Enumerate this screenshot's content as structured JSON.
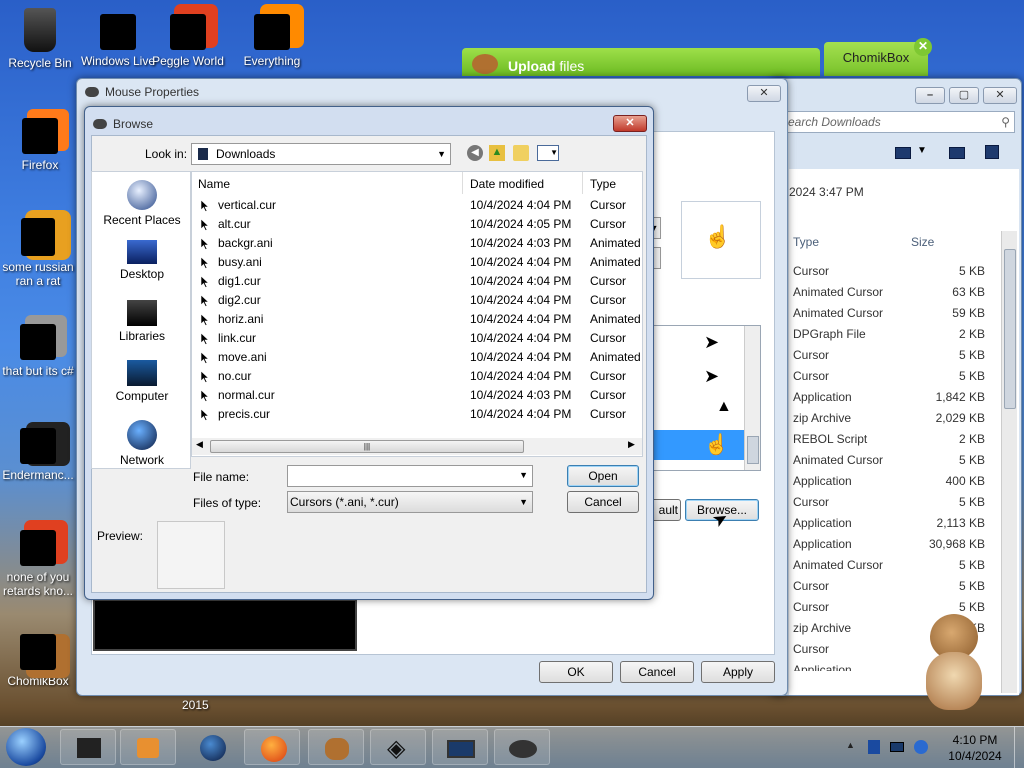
{
  "desktop": {
    "icons": [
      {
        "label": "Recycle Bin",
        "icon": "recycle-bin-icon"
      },
      {
        "label": "Windows Live",
        "icon": "windows-live-icon"
      },
      {
        "label": "Peggle World",
        "icon": "peggle-icon"
      },
      {
        "label": "Everything",
        "icon": "everything-icon"
      },
      {
        "label": "Firefox",
        "icon": "firefox-icon"
      },
      {
        "label": "some russian ran a rat",
        "icon": "file-icon"
      },
      {
        "label": "that but its c#",
        "icon": "file-icon"
      },
      {
        "label": "Endermanc...",
        "icon": "app-icon"
      },
      {
        "label": "none of you retards kno...",
        "icon": "app-icon"
      },
      {
        "label": "ChomikBox",
        "icon": "chomikbox-icon"
      }
    ],
    "year_label": "2015"
  },
  "chomik": {
    "upload_label": "Upload",
    "upload_suffix": "files",
    "tab_label": "ChomikBox"
  },
  "explorer": {
    "search_placeholder": "earch Downloads",
    "date_fragment": "2024 3:47 PM",
    "col_type": "Type",
    "col_size": "Size",
    "rows": [
      {
        "type": "Cursor",
        "size": "5 KB"
      },
      {
        "type": "Animated Cursor",
        "size": "63 KB"
      },
      {
        "type": "Animated Cursor",
        "size": "59 KB"
      },
      {
        "type": "DPGraph File",
        "size": "2 KB"
      },
      {
        "type": "Cursor",
        "size": "5 KB"
      },
      {
        "type": "Cursor",
        "size": "5 KB"
      },
      {
        "type": "Application",
        "size": "1,842 KB"
      },
      {
        "type": "zip Archive",
        "size": "2,029 KB"
      },
      {
        "type": "REBOL Script",
        "size": "2 KB"
      },
      {
        "type": "Animated Cursor",
        "size": "5 KB"
      },
      {
        "type": "Application",
        "size": "400 KB"
      },
      {
        "type": "Cursor",
        "size": "5 KB"
      },
      {
        "type": "Application",
        "size": "2,113 KB"
      },
      {
        "type": "Application",
        "size": "30,968 KB"
      },
      {
        "type": "Animated Cursor",
        "size": "5 KB"
      },
      {
        "type": "Cursor",
        "size": "5 KB"
      },
      {
        "type": "Cursor",
        "size": "5 KB"
      },
      {
        "type": "zip Archive",
        "size": "5 KB"
      },
      {
        "type": "Cursor",
        "size": ""
      },
      {
        "type": "Application",
        "size": ""
      }
    ]
  },
  "mouse_props": {
    "title": "Mouse Properties",
    "default_label": "ault",
    "browse_label": "Browse...",
    "ok_label": "OK",
    "cancel_label": "Cancel",
    "apply_label": "Apply"
  },
  "browse": {
    "title": "Browse",
    "look_in_label": "Look in:",
    "look_in_value": "Downloads",
    "col_name": "Name",
    "col_date": "Date modified",
    "col_type": "Type",
    "places": [
      {
        "label": "Recent Places",
        "icon": "recent-places-icon"
      },
      {
        "label": "Desktop",
        "icon": "desktop-icon"
      },
      {
        "label": "Libraries",
        "icon": "libraries-icon"
      },
      {
        "label": "Computer",
        "icon": "computer-icon"
      },
      {
        "label": "Network",
        "icon": "network-icon"
      }
    ],
    "files": [
      {
        "name": "vertical.cur",
        "date": "10/4/2024 4:04 PM",
        "type": "Cursor"
      },
      {
        "name": "alt.cur",
        "date": "10/4/2024 4:05 PM",
        "type": "Cursor"
      },
      {
        "name": "backgr.ani",
        "date": "10/4/2024 4:03 PM",
        "type": "Animated"
      },
      {
        "name": "busy.ani",
        "date": "10/4/2024 4:04 PM",
        "type": "Animated"
      },
      {
        "name": "dig1.cur",
        "date": "10/4/2024 4:04 PM",
        "type": "Cursor"
      },
      {
        "name": "dig2.cur",
        "date": "10/4/2024 4:04 PM",
        "type": "Cursor"
      },
      {
        "name": "horiz.ani",
        "date": "10/4/2024 4:04 PM",
        "type": "Animated"
      },
      {
        "name": "link.cur",
        "date": "10/4/2024 4:04 PM",
        "type": "Cursor"
      },
      {
        "name": "move.ani",
        "date": "10/4/2024 4:04 PM",
        "type": "Animated"
      },
      {
        "name": "no.cur",
        "date": "10/4/2024 4:04 PM",
        "type": "Cursor"
      },
      {
        "name": "normal.cur",
        "date": "10/4/2024 4:03 PM",
        "type": "Cursor"
      },
      {
        "name": "precis.cur",
        "date": "10/4/2024 4:04 PM",
        "type": "Cursor"
      }
    ],
    "file_name_label": "File name:",
    "file_name_value": "",
    "files_of_type_label": "Files of type:",
    "files_of_type_value": "Cursors (*.ani, *.cur)",
    "open_label": "Open",
    "cancel_label": "Cancel",
    "preview_label": "Preview:"
  },
  "taskbar": {
    "time": "4:10 PM",
    "date": "10/4/2024",
    "items": [
      "start-orb-icon",
      "app-icon",
      "media-player-icon",
      "globe-icon",
      "firefox-icon",
      "chomikbox-icon",
      "unity-icon",
      "monitor-icon",
      "mouse-icon"
    ]
  },
  "colors": {
    "accent": "#3399ff",
    "chomik_green": "#7ec832",
    "selection": "#3399ff"
  }
}
